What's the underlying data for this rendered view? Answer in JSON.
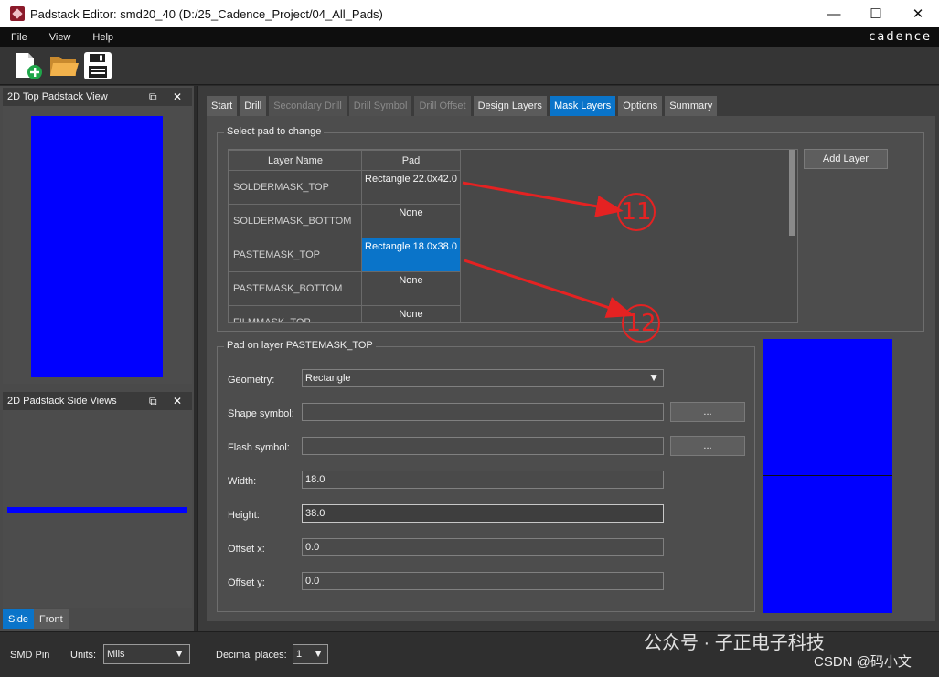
{
  "window": {
    "title": "Padstack Editor: smd20_40  (D:/25_Cadence_Project/04_All_Pads)"
  },
  "menu": {
    "items": [
      "File",
      "View",
      "Help"
    ],
    "brand": "cadence"
  },
  "panes": {
    "top_view": {
      "title": "2D Top Padstack View"
    },
    "side_view": {
      "title": "2D Padstack Side Views"
    },
    "view_tabs": [
      "Side",
      "Front"
    ]
  },
  "tabs": [
    {
      "label": "Start",
      "state": "normal"
    },
    {
      "label": "Drill",
      "state": "normal"
    },
    {
      "label": "Secondary Drill",
      "state": "disabled"
    },
    {
      "label": "Drill Symbol",
      "state": "disabled"
    },
    {
      "label": "Drill Offset",
      "state": "disabled"
    },
    {
      "label": "Design Layers",
      "state": "normal"
    },
    {
      "label": "Mask Layers",
      "state": "active"
    },
    {
      "label": "Options",
      "state": "normal"
    },
    {
      "label": "Summary",
      "state": "normal"
    }
  ],
  "select_pad": {
    "title": "Select pad to change",
    "columns": [
      "Layer Name",
      "Pad"
    ],
    "rows": [
      {
        "layer": "SOLDERMASK_TOP",
        "pad": "Rectangle 22.0x42.0"
      },
      {
        "layer": "SOLDERMASK_BOTTOM",
        "pad": "None"
      },
      {
        "layer": "PASTEMASK_TOP",
        "pad": "Rectangle 18.0x38.0"
      },
      {
        "layer": "PASTEMASK_BOTTOM",
        "pad": "None"
      },
      {
        "layer": "FILMMASK_TOP",
        "pad": "None"
      }
    ],
    "add_layer_label": "Add Layer"
  },
  "pad_on_layer": {
    "title": "Pad on layer PASTEMASK_TOP",
    "geometry_label": "Geometry:",
    "geometry_value": "Rectangle",
    "shape_symbol_label": "Shape symbol:",
    "shape_symbol_value": "",
    "flash_symbol_label": "Flash symbol:",
    "flash_symbol_value": "",
    "browse_label": "...",
    "width_label": "Width:",
    "width_value": "18.0",
    "height_label": "Height:",
    "height_value": "38.0",
    "offset_x_label": "Offset x:",
    "offset_x_value": "0.0",
    "offset_y_label": "Offset y:",
    "offset_y_value": "0.0"
  },
  "status": {
    "pin_type": "SMD Pin",
    "units_label": "Units:",
    "units_value": "Mils",
    "decimal_label": "Decimal places:",
    "decimal_value": "1"
  },
  "annotations": [
    "11",
    "12"
  ],
  "watermark": {
    "line1": "公众号 · 子正电子科技",
    "line2": "CSDN @码小文"
  },
  "colors": {
    "pad_fill": "#0000ff",
    "accent": "#0a74c9",
    "annotation": "#e52222"
  }
}
